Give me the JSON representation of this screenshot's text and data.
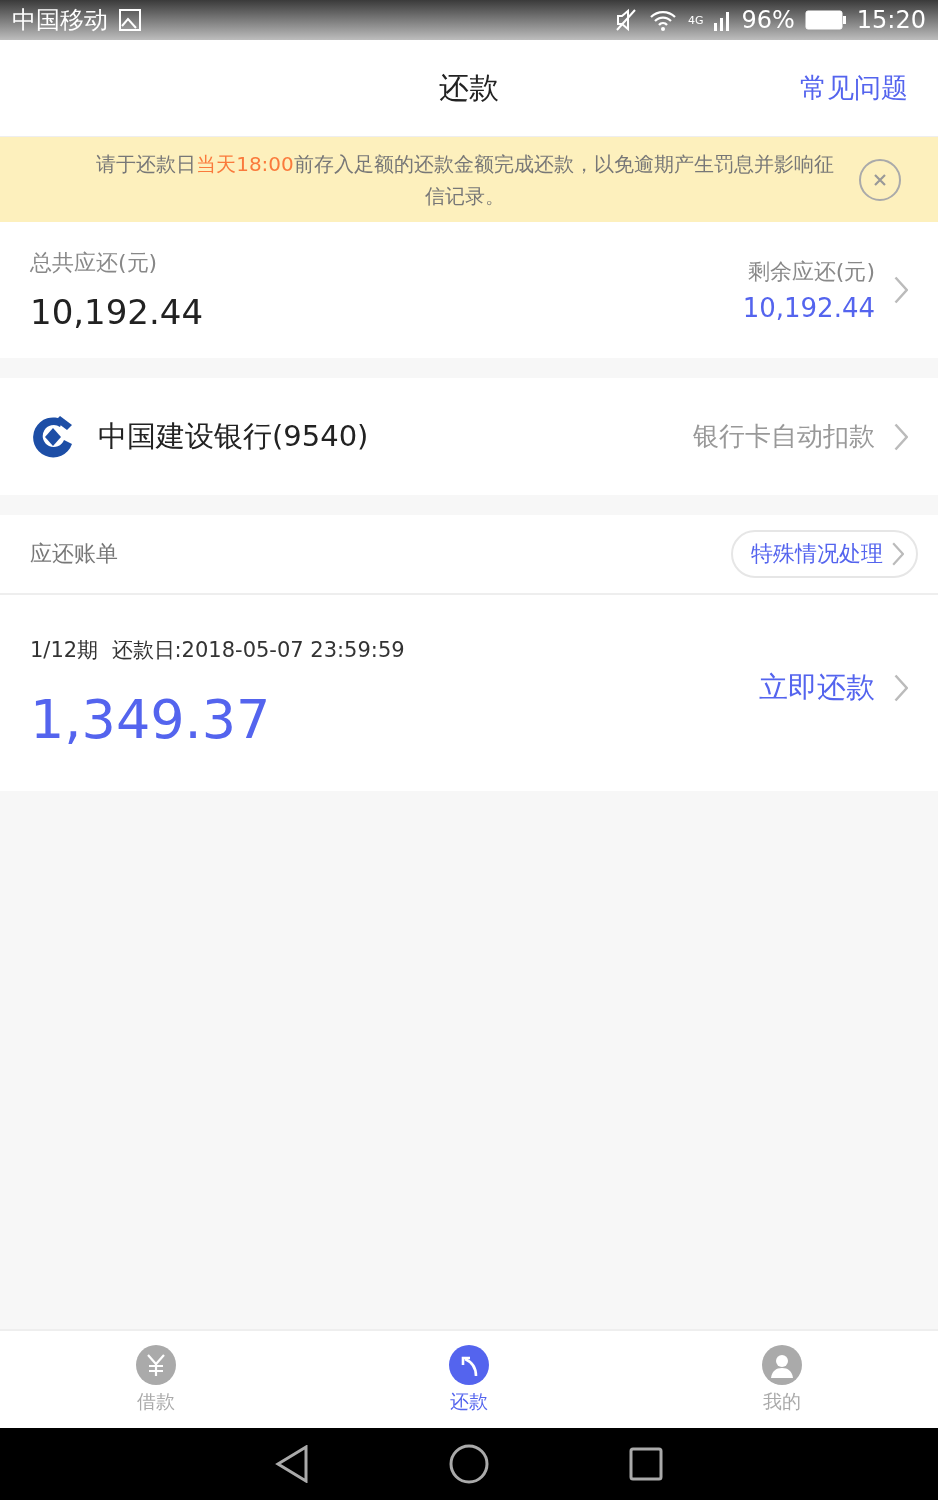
{
  "status_bar": {
    "carrier": "中国移动",
    "network": "4G",
    "battery": "96%",
    "time": "15:20"
  },
  "header": {
    "title": "还款",
    "help_link": "常见问题"
  },
  "notice": {
    "segments": [
      {
        "text": "请于还款日",
        "highlight": false
      },
      {
        "text": "当天18:00",
        "highlight": true
      },
      {
        "text": "前存入足额的还款金额完成还款，以免逾期产生罚息并影响征信记录。",
        "highlight": false
      }
    ]
  },
  "summary": {
    "total_label": "总共应还(元)",
    "total_value": "10,192.44",
    "remaining_label": "剩余应还(元)",
    "remaining_value": "10,192.44"
  },
  "bank_card": {
    "name": "中国建设银行(9540)",
    "method": "银行卡自动扣款"
  },
  "bills": {
    "title": "应还账单",
    "special_button": "特殊情况处理",
    "items": [
      {
        "period": "1/12期",
        "due": "还款日:2018-05-07 23:59:59",
        "amount": "1,349.37",
        "action": "立即还款"
      }
    ]
  },
  "tabs": [
    {
      "label": "借款",
      "kind": "loan",
      "selected": false
    },
    {
      "label": "还款",
      "kind": "repay",
      "selected": true
    },
    {
      "label": "我的",
      "kind": "profile",
      "selected": false
    }
  ]
}
